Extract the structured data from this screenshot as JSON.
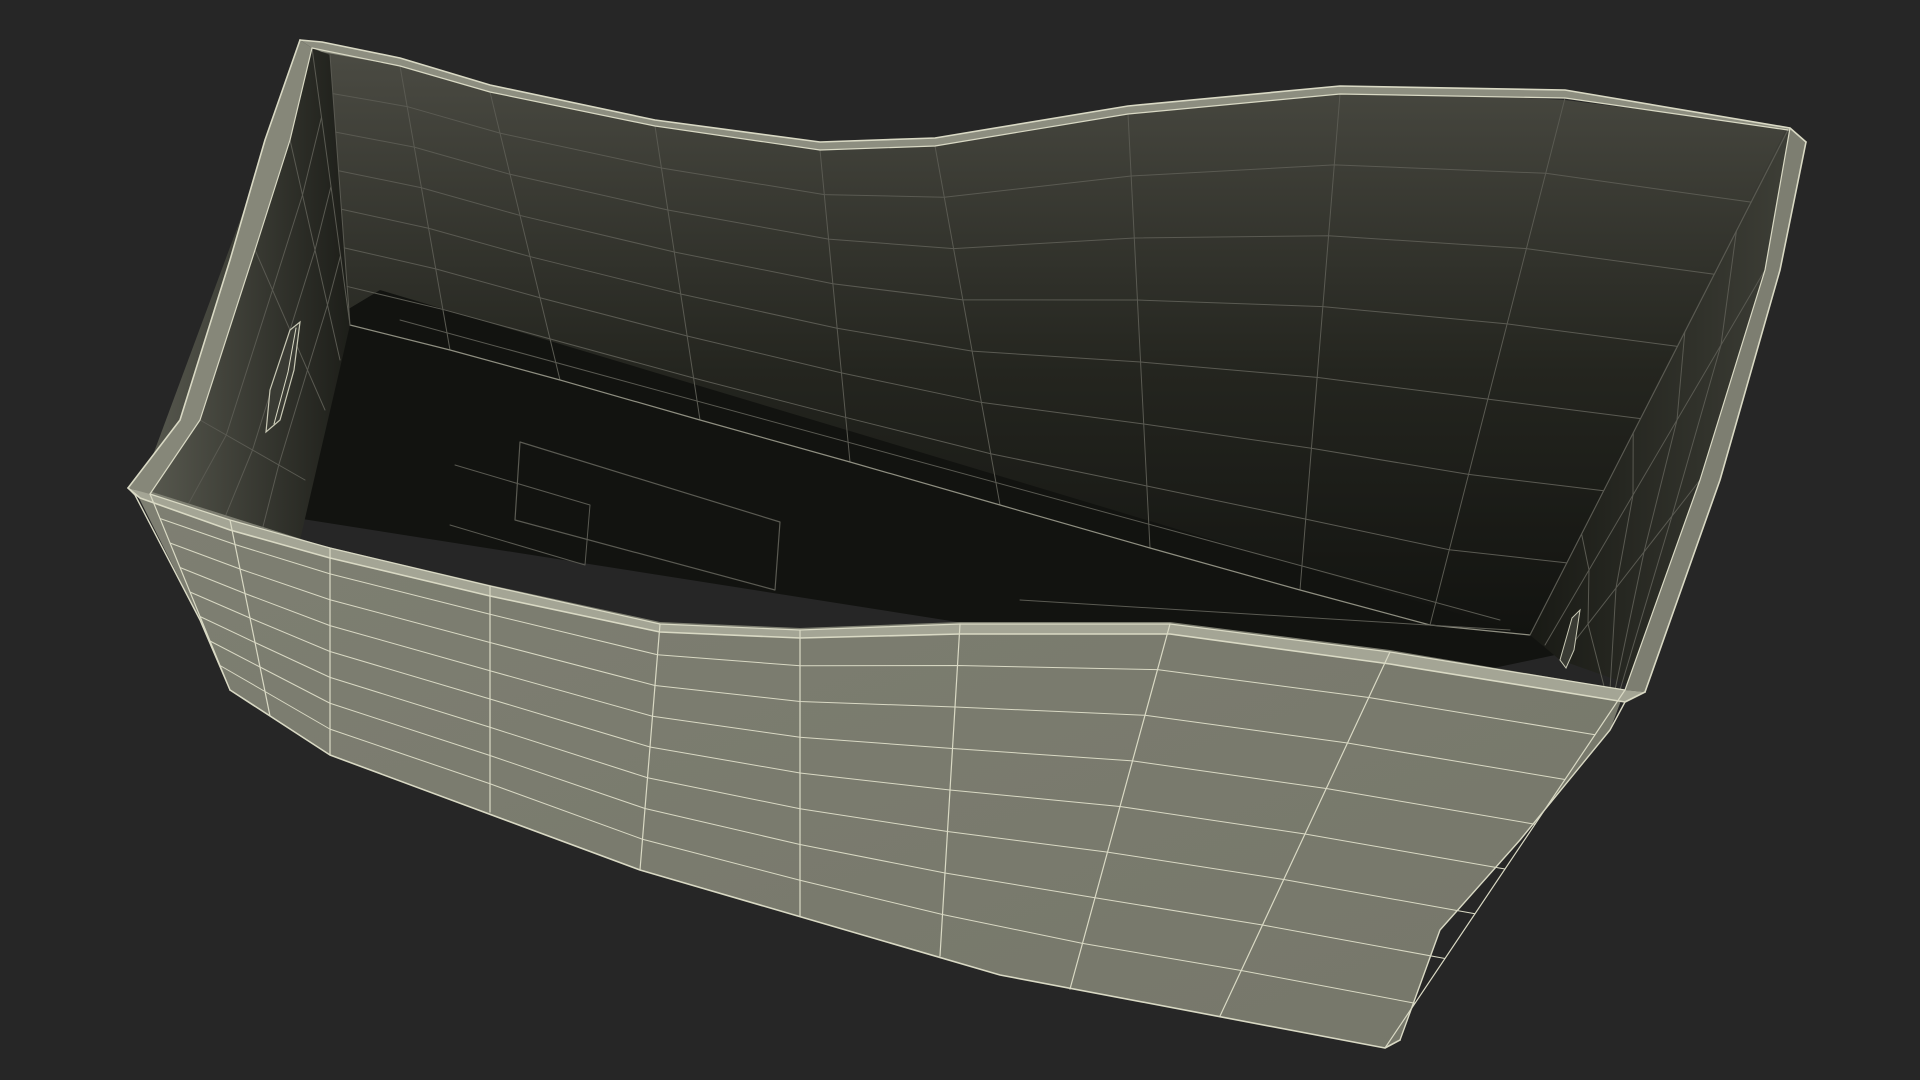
{
  "scene": {
    "background_color": "#262626",
    "outer_face_color": "#7a7b6e",
    "inner_wall_top_color": "#4a4a42",
    "inner_wall_bottom_color": "#14150f",
    "floor_color": "#121310",
    "rim_color": "#8d8e80",
    "wire_color": "#d9d9c4"
  }
}
